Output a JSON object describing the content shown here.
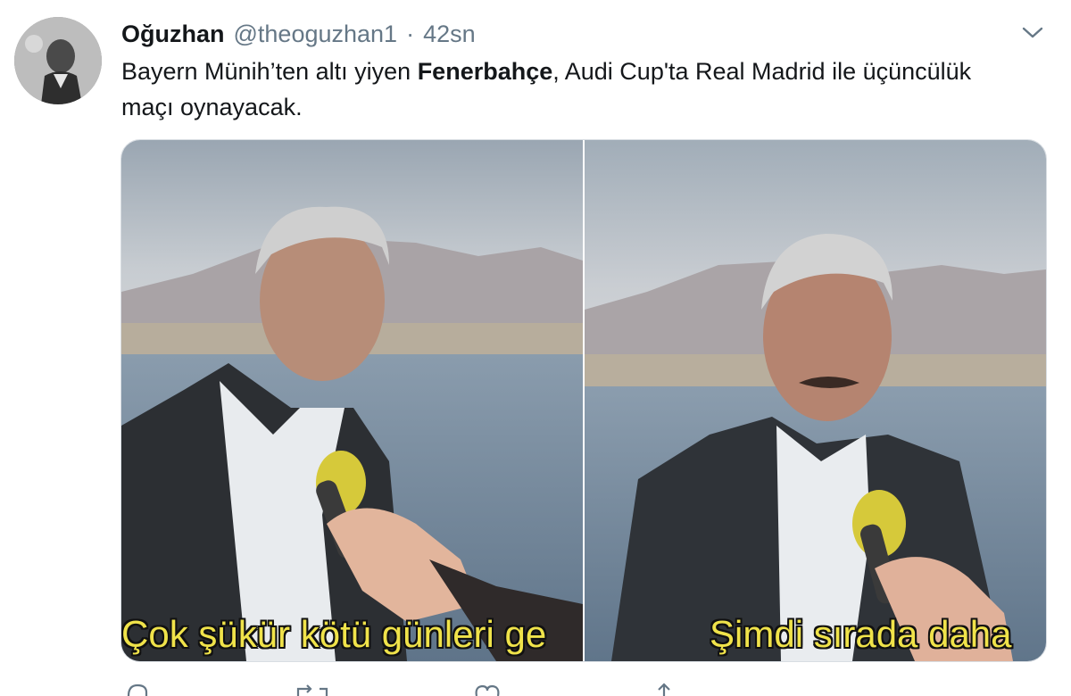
{
  "tweet": {
    "display_name": "Oğuzhan",
    "handle": "@theoguzhan1",
    "separator": "·",
    "time": "42sn",
    "text_part1": "Bayern Münih’ten altı yiyen ",
    "text_bold": "Fenerbahçe",
    "text_part2": ", Audi Cup'ta Real Madrid ile üçüncülük maçı oynayacak."
  },
  "media": {
    "left_subtitle": "Çok şükür kötü günleri ge",
    "right_subtitle": "Şimdi sırada daha"
  },
  "icons": {
    "menu": "chevron-down-icon",
    "reply": "reply-icon",
    "retweet": "retweet-icon",
    "like": "heart-icon",
    "share": "share-icon"
  },
  "colors": {
    "text": "#14171a",
    "secondary": "#657786",
    "subtitle": "#f0e34a"
  }
}
